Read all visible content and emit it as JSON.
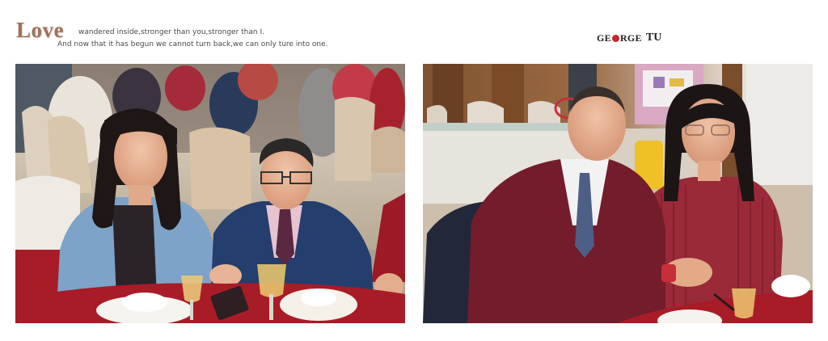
{
  "header": {
    "title": "Love",
    "tagline_line1": "wandered inside,stronger than you,stronger than I.",
    "tagline_line2": "And now that it has begun we cannot turn back,we can only ture into one.",
    "logo_george": "GE  RGE",
    "logo_tu": "TU"
  },
  "photos": [
    {
      "subject": "couple-at-banquet-table-left",
      "accent": "#b01e2a"
    },
    {
      "subject": "couple-at-banquet-table-right",
      "accent": "#7b1c2c"
    }
  ],
  "colors": {
    "title": "#a07058",
    "text": "#4a4a4a",
    "tablecloth": "#b01e2a",
    "logo_red": "#c62828"
  }
}
